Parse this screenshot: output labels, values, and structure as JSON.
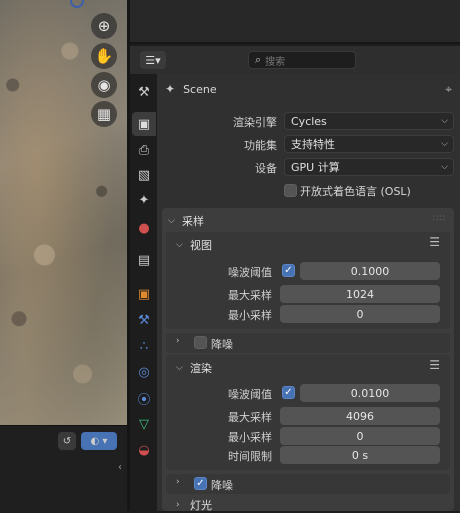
{
  "viewport": {
    "tools": [
      "zoom-icon",
      "hand-icon",
      "camera-icon",
      "grid-icon"
    ]
  },
  "properties": {
    "search": {
      "placeholder": "搜索"
    },
    "scene": {
      "name": "Scene"
    },
    "render": {
      "engine_label": "渲染引擎",
      "engine_value": "Cycles",
      "feature_set_label": "功能集",
      "feature_set_value": "支持特性",
      "device_label": "设备",
      "device_value": "GPU 计算",
      "osl_label": "开放式着色语言 (OSL)",
      "osl_checked": false
    },
    "sampling": {
      "title": "采样",
      "viewport": {
        "title": "视图",
        "noise_threshold_label": "噪波阈值",
        "noise_threshold_enabled": true,
        "noise_threshold_value": "0.1000",
        "max_samples_label": "最大采样",
        "max_samples_value": "1024",
        "min_samples_label": "最小采样",
        "min_samples_value": "0",
        "denoise_label": "降噪",
        "denoise_enabled": false
      },
      "render": {
        "title": "渲染",
        "noise_threshold_label": "噪波阈值",
        "noise_threshold_enabled": true,
        "noise_threshold_value": "0.0100",
        "max_samples_label": "最大采样",
        "max_samples_value": "4096",
        "min_samples_label": "最小采样",
        "min_samples_value": "0",
        "time_limit_label": "时间限制",
        "time_limit_value": "0 s",
        "denoise_label": "降噪",
        "denoise_enabled": true
      }
    },
    "light_paths": {
      "title": "灯光"
    }
  },
  "colors": {
    "accent_blue": "#4772b3",
    "panel_bg": "#3d3d3d",
    "field_bg": "#545454"
  }
}
